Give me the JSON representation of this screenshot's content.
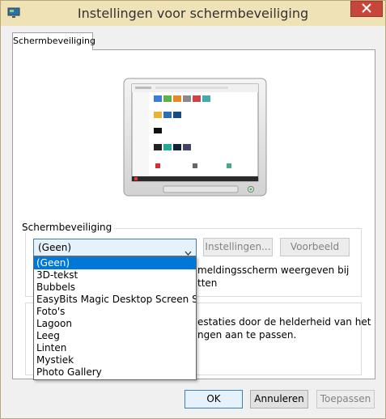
{
  "window": {
    "title": "Instellingen voor schermbeveiliging",
    "title_icon": "screensaver-app-icon",
    "close_icon": "close-icon",
    "titlebar_color": "#efe2b7",
    "close_color": "#c7463b"
  },
  "tabs": [
    {
      "label": "Schermbeveiliging"
    }
  ],
  "screensaver_group": {
    "label": "Schermbeveiliging",
    "selected": "(Geen)",
    "settings_button": "Instellingen...",
    "preview_button": "Voorbeeld",
    "resume_text_line1": "meldingsscherm weergeven bij",
    "resume_text_line2": "tten"
  },
  "power_group": {
    "text_line1": "estaties door de helderheid van het",
    "text_line2": "ngen aan te passen."
  },
  "dropdown": {
    "options": [
      "(Geen)",
      "3D-tekst",
      "Bubbels",
      "EasyBits Magic Desktop Screen Saver",
      "Foto's",
      "Lagoon",
      "Leeg",
      "Linten",
      "Mystiek",
      "Photo Gallery"
    ],
    "selected_index": 0,
    "highlight_color": "#0078d7"
  },
  "buttons": {
    "ok": "OK",
    "cancel": "Annuleren",
    "apply": "Toepassen"
  }
}
